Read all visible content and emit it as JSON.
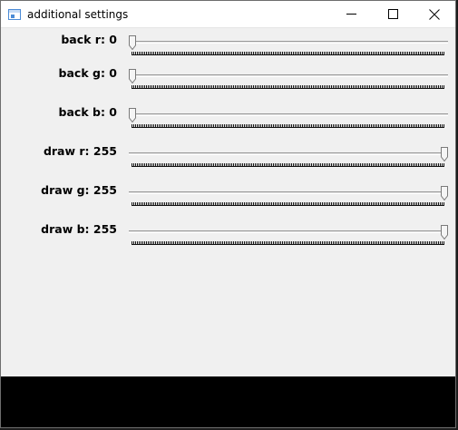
{
  "window": {
    "title": "additional settings",
    "controls": {
      "minimize": "minimize-icon",
      "maximize": "maximize-icon",
      "close": "close-icon"
    }
  },
  "sliders": [
    {
      "id": "back-r",
      "label": "back r: 0",
      "value": 0,
      "max": 255
    },
    {
      "id": "back-g",
      "label": "back g: 0",
      "value": 0,
      "max": 255
    },
    {
      "id": "back-b",
      "label": "back b: 0",
      "value": 0,
      "max": 255
    },
    {
      "id": "draw-r",
      "label": "draw r: 255",
      "value": 255,
      "max": 255
    },
    {
      "id": "draw-g",
      "label": "draw g: 255",
      "value": 255,
      "max": 255
    },
    {
      "id": "draw-b",
      "label": "draw b: 255",
      "value": 255,
      "max": 255
    }
  ],
  "colors": {
    "window_bg": "#f0f0f0",
    "bottom_bar": "#000000"
  }
}
